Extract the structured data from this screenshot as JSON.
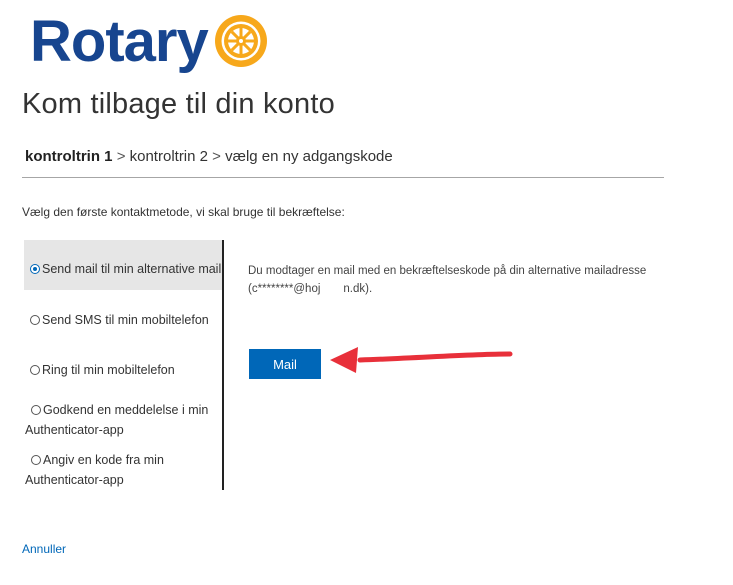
{
  "brand": {
    "logo_text": "Rotary",
    "logo_color": "#17458f",
    "wheel_color": "#f7a81b",
    "wheel_icon": "rotary-wheel-icon"
  },
  "page": {
    "title": "Kom tilbage til din konto"
  },
  "breadcrumb": {
    "step1": "kontroltrin 1",
    "step2": "kontroltrin 2",
    "step3": "vælg en ny adgangskode",
    "separator": ">"
  },
  "instruction": "Vælg den første kontaktmetode, vi skal bruge til bekræftelse:",
  "methods": [
    {
      "label": "Send mail til min alternative mail",
      "selected": true
    },
    {
      "label": "Send SMS til min mobiltelefon",
      "selected": false
    },
    {
      "label": "Ring til min mobiltelefon",
      "selected": false
    },
    {
      "label_line1": "Godkend en meddelelse i min",
      "label_line2": "Authenticator-app",
      "selected": false
    },
    {
      "label_line1": "Angiv en kode fra min",
      "label_line2": "Authenticator-app",
      "selected": false
    }
  ],
  "detail": {
    "line1": "Du modtager en mail med en bekræftelseskode på din alternative mailadresse",
    "line2": "(c********@hoj  n.dk)."
  },
  "mail_button": "Mail",
  "cancel": "Annuller",
  "colors": {
    "accent": "#0067b8",
    "annotation_arrow": "#e8303a",
    "selected_bg": "#e6e6e6"
  }
}
